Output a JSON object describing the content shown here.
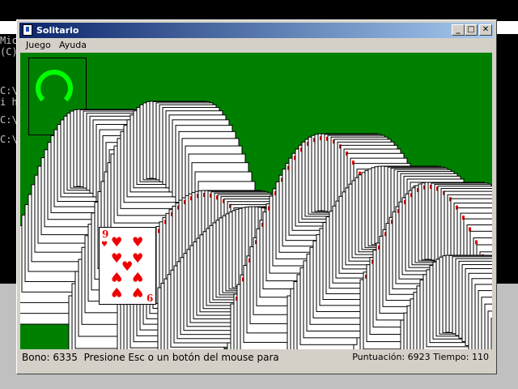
{
  "console": {
    "lines": [
      "Mic",
      "(C)",
      "C:\\",
      "i h",
      "C:\\",
      "C:\\"
    ]
  },
  "window": {
    "title": "Solitario",
    "controls": {
      "minimize": "_",
      "maximize": "□",
      "close": "✕"
    }
  },
  "menu": [
    "Juego",
    "Ayuda"
  ],
  "card": {
    "rank": "9",
    "suit": "♥"
  },
  "status": {
    "bonus_label": "Bono:",
    "bonus_value": "6335",
    "message": "Presione Esc o un botón del mouse para",
    "score_label": "Puntuación:",
    "score_value": "6923",
    "time_label": "Tiempo:",
    "time_value": "110"
  },
  "colors": {
    "felt": "#008000",
    "card_red": "#e00000",
    "deck_ring": "#00ff00",
    "titlebar_start": "#0a246a",
    "titlebar_end": "#a6caf0"
  }
}
